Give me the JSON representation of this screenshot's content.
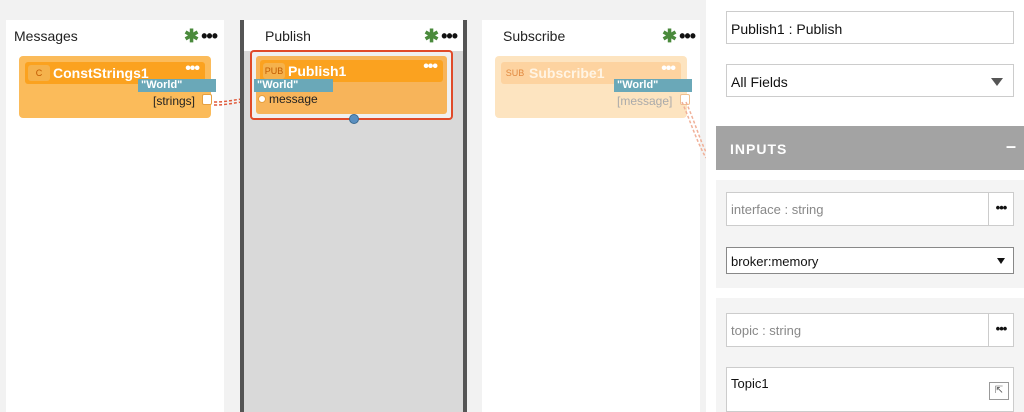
{
  "columns": {
    "messages": {
      "title": "Messages"
    },
    "publish": {
      "title": "Publish"
    },
    "subscribe": {
      "title": "Subscribe"
    }
  },
  "nodes": {
    "const_strings": {
      "badge": "C",
      "name": "ConstStrings1",
      "chip": "\"World\"",
      "port": "[strings]"
    },
    "publish": {
      "badge": "PUB",
      "name": "Publish1",
      "chip": "\"World\"",
      "port": "message"
    },
    "subscribe": {
      "badge": "SUB",
      "name": "Subscribe1",
      "chip": "\"World\"",
      "port": "[message]"
    }
  },
  "panel": {
    "title_field": "Publish1 : Publish",
    "fields_select": "All Fields",
    "inputs_header": "INPUTS",
    "collapse_symbol": "–",
    "interface_label": "interface : string",
    "interface_value": "broker:memory",
    "topic_label": "topic : string",
    "topic_value": "Topic1"
  },
  "colors": {
    "accent": "#fba21f",
    "chip": "#6aa8b8",
    "selection": "#e04a2a",
    "header": "#a3a3a3"
  }
}
